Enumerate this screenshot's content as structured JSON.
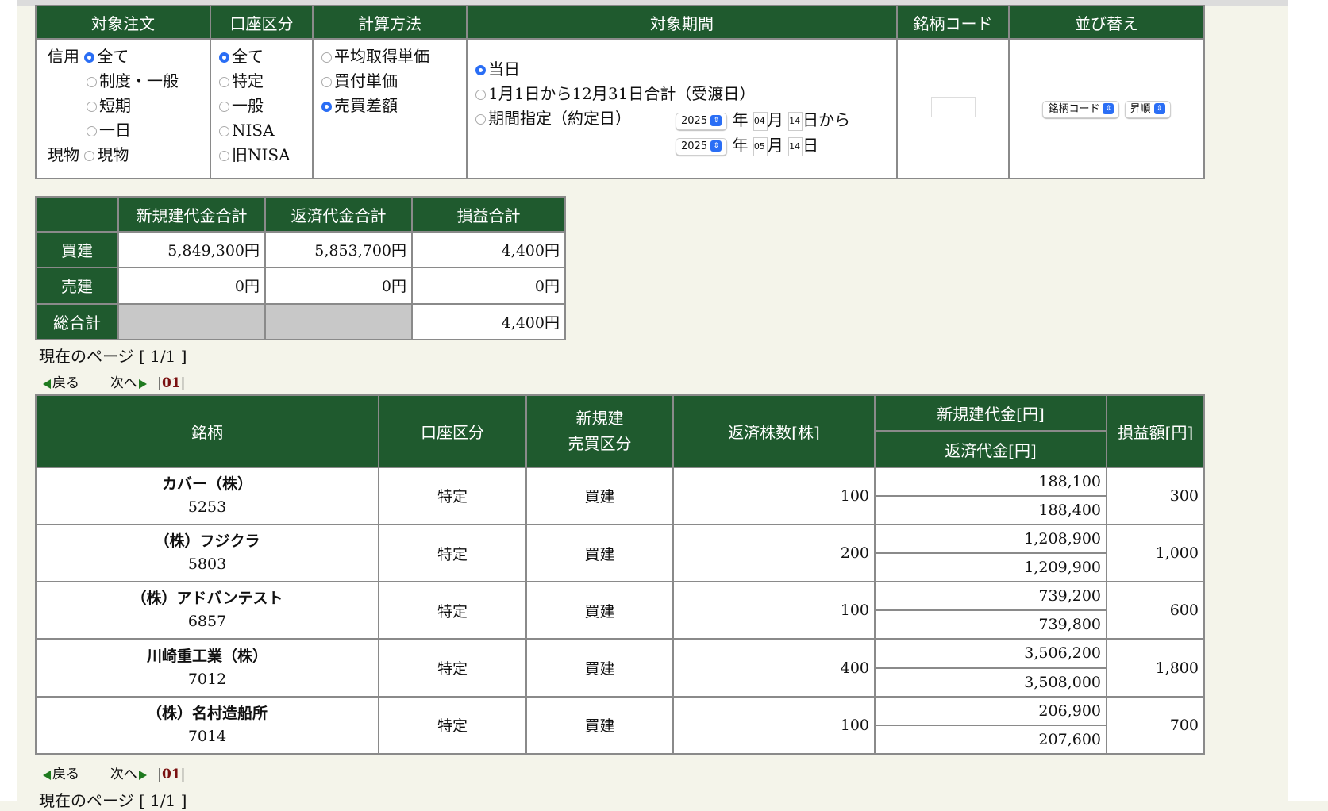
{
  "filter": {
    "headers": [
      "対象注文",
      "口座区分",
      "計算方法",
      "対象期間",
      "銘柄コード",
      "並び替え"
    ],
    "order": {
      "margin_label": "信用",
      "spot_label": "現物",
      "margin_options": [
        "全て",
        "制度・一般",
        "短期",
        "一日"
      ],
      "spot_option": "現物",
      "selected": "全て"
    },
    "account": {
      "options": [
        "全て",
        "特定",
        "一般",
        "NISA",
        "旧NISA"
      ],
      "selected": "全て"
    },
    "calc": {
      "options": [
        "平均取得単価",
        "買付単価",
        "売買差額"
      ],
      "selected": "売買差額"
    },
    "period": {
      "options": [
        "当日",
        "1月1日から12月31日合計（受渡日）",
        "期間指定（約定日）"
      ],
      "selected": "当日",
      "from": {
        "year": "2025",
        "month": "04",
        "day": "14"
      },
      "to": {
        "year": "2025",
        "month": "05",
        "day": "14"
      },
      "year_label": "年",
      "month_label": "月",
      "day_from_label": "日から",
      "day_to_label": "日"
    },
    "sort": {
      "field": "銘柄コード",
      "order": "昇順"
    }
  },
  "summary": {
    "headers": [
      "新規建代金合計",
      "返済代金合計",
      "損益合計"
    ],
    "rows": [
      {
        "label": "買建",
        "new": "5,849,300円",
        "ret": "5,853,700円",
        "pl": "4,400円"
      },
      {
        "label": "売建",
        "new": "0円",
        "ret": "0円",
        "pl": "0円"
      },
      {
        "label": "総合計",
        "new": "",
        "ret": "",
        "pl": "4,400円"
      }
    ]
  },
  "pager": {
    "current_page_text": "現在のページ [ 1/1 ]",
    "back": "戻る",
    "next": "次へ",
    "page": "01"
  },
  "trades": {
    "headers": {
      "name": "銘柄",
      "account": "口座区分",
      "side_top": "新規建",
      "side_bottom": "売買区分",
      "qty": "返済株数[株]",
      "new_amount": "新規建代金[円]",
      "ret_amount": "返済代金[円]",
      "pl": "損益額[円]"
    },
    "rows": [
      {
        "name": "カバー（株）",
        "code": "5253",
        "account": "特定",
        "side": "買建",
        "qty": "100",
        "new": "188,100",
        "ret": "188,400",
        "pl": "300"
      },
      {
        "name": "（株）フジクラ",
        "code": "5803",
        "account": "特定",
        "side": "買建",
        "qty": "200",
        "new": "1,208,900",
        "ret": "1,209,900",
        "pl": "1,000"
      },
      {
        "name": "（株）アドバンテスト",
        "code": "6857",
        "account": "特定",
        "side": "買建",
        "qty": "100",
        "new": "739,200",
        "ret": "739,800",
        "pl": "600"
      },
      {
        "name": "川崎重工業（株）",
        "code": "7012",
        "account": "特定",
        "side": "買建",
        "qty": "400",
        "new": "3,506,200",
        "ret": "3,508,000",
        "pl": "1,800"
      },
      {
        "name": "（株）名村造船所",
        "code": "7014",
        "account": "特定",
        "side": "買建",
        "qty": "100",
        "new": "206,900",
        "ret": "207,600",
        "pl": "700"
      }
    ]
  }
}
